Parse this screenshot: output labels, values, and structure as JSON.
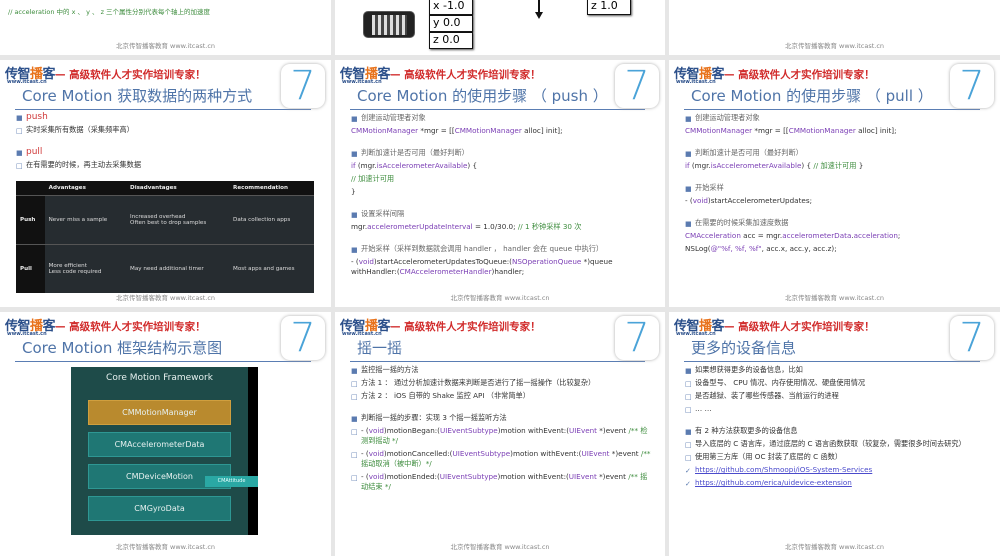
{
  "common": {
    "logo": "传智",
    "logo_accent": "播",
    "logo_end": "客",
    "logo_url": "www.itcast.cn",
    "tagline": "— 高级软件人才实作培训专家！",
    "footer": "北京传智播客教育  www.itcast.cn",
    "ios_badge": "7"
  },
  "top": {
    "comment": "// acceleration 中的 x 、 y 、 z 三个属性分别代表每个轴上的加速度",
    "boxes": [
      "x -1.0",
      "y  0.0",
      "z  0.0"
    ],
    "box_right": "z  1.0"
  },
  "slides": [
    {
      "title": "Core Motion 获取数据的两种方式",
      "items": [
        {
          "mk": "■",
          "segs": [
            {
              "t": "push",
              "c": "red"
            }
          ]
        },
        {
          "mk": "□",
          "segs": [
            {
              "t": "实时采集所有数据（采集频率高）"
            }
          ]
        },
        {
          "gap": true
        },
        {
          "mk": "■",
          "segs": [
            {
              "t": "pull",
              "c": "red"
            }
          ]
        },
        {
          "mk": "□",
          "segs": [
            {
              "t": "在有需要的时候，再主动去采集数据"
            }
          ]
        }
      ],
      "table": {
        "headers": [
          "",
          "Advantages",
          "Disadvantages",
          "Recommendation"
        ],
        "rows": [
          [
            "Push",
            "Never miss a sample",
            "Increased overhead\nOften best to drop samples",
            "Data collection apps"
          ],
          [
            "Pull",
            "More efficient\nLess code required",
            "May need additional timer",
            "Most apps and games"
          ]
        ]
      }
    },
    {
      "title": "Core Motion 的使用步骤 （ push ）",
      "items": [
        {
          "mk": "■",
          "segs": [
            {
              "t": "创建运动管理者对象",
              "c": "gray"
            }
          ]
        },
        {
          "code": true,
          "segs": [
            {
              "t": "CMMotionManager",
              "c": "purple"
            },
            {
              "t": " *mgr = [["
            },
            {
              "t": "CMMotionManager",
              "c": "purple"
            },
            {
              "t": " alloc] init];"
            }
          ]
        },
        {
          "gap": true
        },
        {
          "mk": "■",
          "segs": [
            {
              "t": "判断加速计是否可用（最好判断）",
              "c": "gray"
            }
          ]
        },
        {
          "code": true,
          "segs": [
            {
              "t": "if",
              "c": "purple"
            },
            {
              "t": " (mgr."
            },
            {
              "t": "isAccelerometerAvailable",
              "c": "purple"
            },
            {
              "t": ") {"
            }
          ]
        },
        {
          "code": true,
          "segs": [
            {
              "t": "    // 加速计可用",
              "c": "green"
            }
          ]
        },
        {
          "code": true,
          "segs": [
            {
              "t": "}"
            }
          ]
        },
        {
          "gap": true
        },
        {
          "mk": "■",
          "segs": [
            {
              "t": "设置采样间隔",
              "c": "gray"
            }
          ]
        },
        {
          "code": true,
          "segs": [
            {
              "t": "mgr."
            },
            {
              "t": "accelerometerUpdateInterval",
              "c": "purple"
            },
            {
              "t": " = 1.0/30.0; "
            },
            {
              "t": "// 1 秒钟采样 30 次",
              "c": "green"
            }
          ]
        },
        {
          "gap": true
        },
        {
          "mk": "■",
          "segs": [
            {
              "t": "开始采样（采样到数据就会调用 handler ， handler 会在 queue 中执行）",
              "c": "gray"
            }
          ]
        },
        {
          "code": true,
          "segs": [
            {
              "t": "- ("
            },
            {
              "t": "void",
              "c": "purple"
            },
            {
              "t": ")startAccelerometerUpdatesToQueue:("
            },
            {
              "t": "NSOperationQueue",
              "c": "purple"
            },
            {
              "t": " *)queue withHandler:("
            },
            {
              "t": "CMAccelerometerHandler",
              "c": "purple"
            },
            {
              "t": ")handler;"
            }
          ]
        }
      ]
    },
    {
      "title": "Core Motion 的使用步骤 （ pull ）",
      "items": [
        {
          "mk": "■",
          "segs": [
            {
              "t": "创建运动管理者对象",
              "c": "gray"
            }
          ]
        },
        {
          "code": true,
          "segs": [
            {
              "t": "CMMotionManager",
              "c": "purple"
            },
            {
              "t": " *mgr = [["
            },
            {
              "t": "CMMotionManager",
              "c": "purple"
            },
            {
              "t": " alloc] init];"
            }
          ]
        },
        {
          "gap": true
        },
        {
          "mk": "■",
          "segs": [
            {
              "t": "判断加速计是否可用（最好判断）",
              "c": "gray"
            }
          ]
        },
        {
          "code": true,
          "segs": [
            {
              "t": "if",
              "c": "purple"
            },
            {
              "t": " (mgr."
            },
            {
              "t": "isAccelerometerAvailable",
              "c": "purple"
            },
            {
              "t": ") { "
            },
            {
              "t": "// 加速计可用",
              "c": "green"
            },
            {
              "t": " }"
            }
          ]
        },
        {
          "gap": true
        },
        {
          "mk": "■",
          "segs": [
            {
              "t": "开始采样",
              "c": "gray"
            }
          ]
        },
        {
          "code": true,
          "segs": [
            {
              "t": "- ("
            },
            {
              "t": "void",
              "c": "purple"
            },
            {
              "t": ")startAccelerometerUpdates;"
            }
          ]
        },
        {
          "gap": true
        },
        {
          "mk": "■",
          "segs": [
            {
              "t": "在需要的时候采集加速度数据",
              "c": "gray"
            }
          ]
        },
        {
          "code": true,
          "segs": [
            {
              "t": "CMAcceleration",
              "c": "purple"
            },
            {
              "t": " acc = mgr."
            },
            {
              "t": "accelerometerData",
              "c": "purple"
            },
            {
              "t": "."
            },
            {
              "t": "acceleration",
              "c": "purple"
            },
            {
              "t": ";"
            }
          ]
        },
        {
          "code": true,
          "segs": [
            {
              "t": "NSLog("
            },
            {
              "t": "@\"%f, %f, %f\"",
              "c": "purple"
            },
            {
              "t": ", acc.x, acc.y, acc.z);"
            }
          ]
        }
      ]
    },
    {
      "title": "Core Motion 框架结构示意图",
      "framework": {
        "title": "Core Motion Framework",
        "boxes": [
          "CMMotionManager",
          "CMAccelerometerData",
          "CMDeviceMotion",
          "CMGyroData"
        ],
        "attitude": "CMAttitude"
      }
    },
    {
      "title": "摇一摇",
      "items": [
        {
          "mk": "■",
          "segs": [
            {
              "t": "监控摇一摇的方法"
            }
          ]
        },
        {
          "mk": "□",
          "segs": [
            {
              "t": "方法 1 ： 通过分析加速计数据来判断是否进行了摇一摇操作（比较复杂）"
            }
          ]
        },
        {
          "mk": "□",
          "segs": [
            {
              "t": "方法 2 ： iOS 自带的 Shake 监控 API （非常简单）"
            }
          ]
        },
        {
          "gap": true
        },
        {
          "mk": "■",
          "segs": [
            {
              "t": "判断摇一摇的步骤：实现 3 个摇一摇监听方法"
            }
          ]
        },
        {
          "mk": "□",
          "segs": [
            {
              "t": "- ("
            },
            {
              "t": "void",
              "c": "purple"
            },
            {
              "t": ")motionBegan:("
            },
            {
              "t": "UIEventSubtype",
              "c": "purple"
            },
            {
              "t": ")motion withEvent:("
            },
            {
              "t": "UIEvent",
              "c": "purple"
            },
            {
              "t": " *)event "
            },
            {
              "t": "/** 检测到摇动 */",
              "c": "green"
            }
          ]
        },
        {
          "mk": "□",
          "segs": [
            {
              "t": "- ("
            },
            {
              "t": "void",
              "c": "purple"
            },
            {
              "t": ")motionCancelled:("
            },
            {
              "t": "UIEventSubtype",
              "c": "purple"
            },
            {
              "t": ")motion withEvent:("
            },
            {
              "t": "UIEvent",
              "c": "purple"
            },
            {
              "t": " *)event "
            },
            {
              "t": "/** 摇动取消（被中断）*/",
              "c": "green"
            }
          ]
        },
        {
          "mk": "□",
          "segs": [
            {
              "t": "- ("
            },
            {
              "t": "void",
              "c": "purple"
            },
            {
              "t": ")motionEnded:("
            },
            {
              "t": "UIEventSubtype",
              "c": "purple"
            },
            {
              "t": ")motion withEvent:("
            },
            {
              "t": "UIEvent",
              "c": "purple"
            },
            {
              "t": " *)event "
            },
            {
              "t": "/** 摇动结束 */",
              "c": "green"
            }
          ]
        }
      ]
    },
    {
      "title": "更多的设备信息",
      "items": [
        {
          "mk": "■",
          "segs": [
            {
              "t": "如果想获得更多的设备信息，比如"
            }
          ]
        },
        {
          "mk": "□",
          "segs": [
            {
              "t": "设备型号、 CPU 情况、内存使用情况、硬盘使用情况"
            }
          ]
        },
        {
          "mk": "□",
          "segs": [
            {
              "t": "是否越狱、装了哪些传感器、当前运行的进程"
            }
          ]
        },
        {
          "mk": "□",
          "segs": [
            {
              "t": "… …"
            }
          ]
        },
        {
          "gap": true
        },
        {
          "mk": "■",
          "segs": [
            {
              "t": "有 2 种方法获取更多的设备信息"
            }
          ]
        },
        {
          "mk": "□",
          "segs": [
            {
              "t": "导入底层的 C 语言库，通过底层的 C 语言函数获取（较复杂，需要很多时间去研究）"
            }
          ]
        },
        {
          "mk": "□",
          "segs": [
            {
              "t": "使用第三方库（用 OC 封装了底层的 C 函数）"
            }
          ]
        },
        {
          "mk": "✓",
          "segs": [
            {
              "t": "https://github.com/Shmoopi/iOS-System-Services",
              "c": "link"
            }
          ]
        },
        {
          "mk": "✓",
          "segs": [
            {
              "t": "https://github.com/erica/uidevice-extension",
              "c": "link"
            }
          ]
        }
      ]
    }
  ]
}
